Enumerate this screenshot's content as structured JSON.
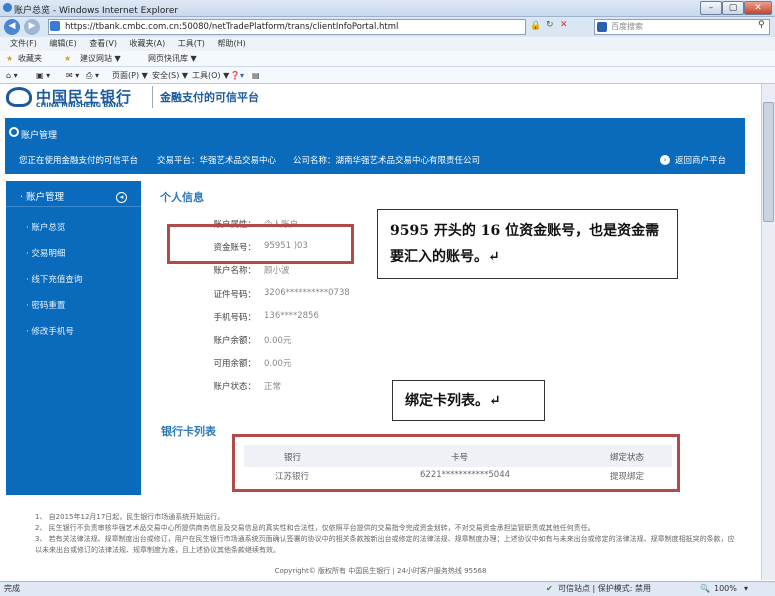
{
  "window": {
    "title": "账户总览 - Windows Internet Explorer"
  },
  "addressbar": {
    "url": "https://tbank.cmbc.com.cn:50080/netTradePlatform/trans/clientInfoPortal.html",
    "search_placeholder": "百度搜索"
  },
  "menu": [
    "文件(F)",
    "编辑(E)",
    "查看(V)",
    "收藏夹(A)",
    "工具(T)",
    "帮助(H)"
  ],
  "favorites": {
    "label": "收藏夹",
    "items": [
      "建议网站 ▼",
      "网页快讯库 ▼"
    ]
  },
  "commandbar": [
    "页面(P) ▼",
    "安全(S) ▼",
    "工具(O) ▼"
  ],
  "header": {
    "bank_cn": "中国民生银行",
    "bank_en": "CHINA MINSHENG BANK",
    "slogan": "金融支付的可信平台"
  },
  "bluebar": {
    "section": "账户管理",
    "using": "您正在使用金融支付的可信平台",
    "platform": "交易平台：华强艺术品交易中心",
    "company": "公司名称：湖南华强艺术品交易中心有限责任公司",
    "back": "返回商户平台"
  },
  "sidebar": {
    "title": "· 账户管理",
    "items": [
      "· 账户总览",
      "· 交易明细",
      "· 线下充值查询",
      "· 密码重置",
      "· 修改手机号"
    ]
  },
  "personal": {
    "title": "个人信息",
    "rows": [
      {
        "label": "账户属性：",
        "value": "个人账户"
      },
      {
        "label": "资金账号：",
        "value": "95951            )03"
      },
      {
        "label": "账户名称：",
        "value": "顾小波"
      },
      {
        "label": "证件号码：",
        "value": "3206**********0738"
      },
      {
        "label": "手机号码：",
        "value": "136****2856"
      },
      {
        "label": "账户余额：",
        "value": "0.00元"
      },
      {
        "label": "可用余额：",
        "value": "0.00元"
      },
      {
        "label": "账户状态：",
        "value": "正常"
      }
    ]
  },
  "bankcards": {
    "title": "银行卡列表",
    "headers": [
      "银行",
      "卡号",
      "绑定状态"
    ],
    "rows": [
      [
        "江苏银行",
        "6221***********5044",
        "提现绑定"
      ]
    ]
  },
  "callouts": {
    "account": "9595 开头的 16 位资金账号，也是资金需要汇入的账号。↵",
    "cards": "绑定卡列表。↵"
  },
  "footer": {
    "lines": [
      "1、 自2015年12月17日起，民生银行市场通系统开始运行。",
      "2、 民生银行不负责审核华强艺术品交易中心所提供商务信息及交易信息的真实性和合法性，仅依照平台提供的交易指令完成资金划转，不对交易资金承担监管职责或其他任何责任。",
      "3、 若有关法律法规、规章制度出台或修订，用户在民生银行市场通系统页面确认签署的协议中的相关条款按新出台或修定的法律法规、规章制度办理；上述协议中如有与未来出台或修定的法律法规、规章制度相抵突的条款，应以未来出台或修订的法律法规、规章制度为准，且上述协议其他条款继续有效。"
    ],
    "copyright": "Copyright© 版权所有  中国民生银行  | 24小时客户服务热线  95568"
  },
  "statusbar": {
    "left": "完成",
    "trusted": "可信站点 | 保护模式: 禁用",
    "zoom": "100%"
  }
}
